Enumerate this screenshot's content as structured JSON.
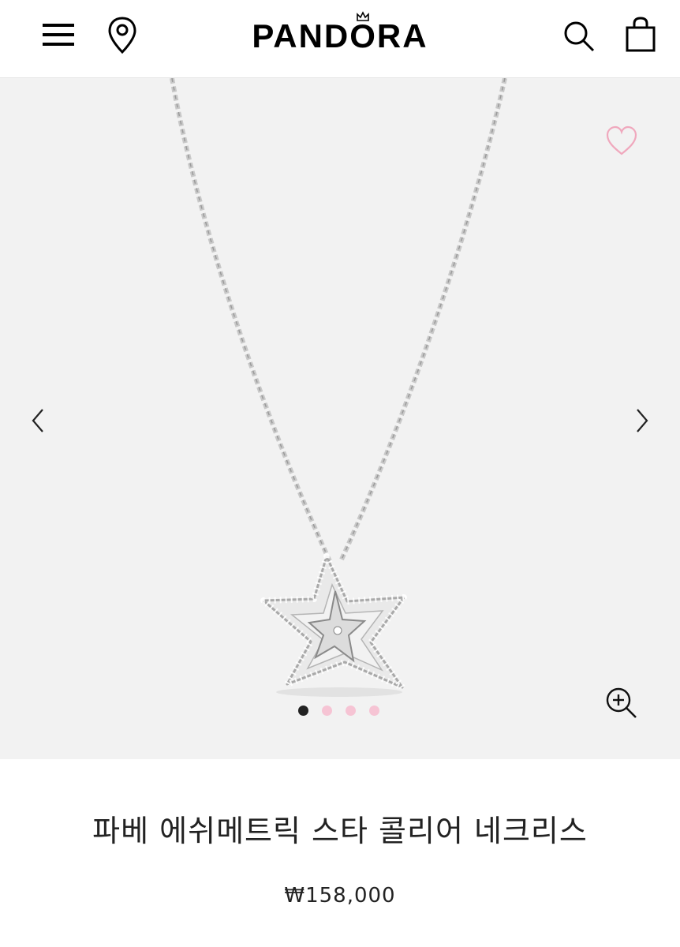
{
  "header": {
    "brand": "PANDORA",
    "icons": {
      "menu": "hamburger-menu-icon",
      "location": "map-pin-icon",
      "search": "search-icon",
      "bag": "shopping-bag-icon"
    }
  },
  "gallery": {
    "image": "star-pendant-necklace",
    "wishlist_icon": "heart-icon",
    "prev_icon": "chevron-left-icon",
    "next_icon": "chevron-right-icon",
    "zoom_icon": "zoom-in-icon",
    "slides_total": 4,
    "active_slide": 1
  },
  "product": {
    "title": "파베 에쉬메트릭 스타 콜리어 네크리스",
    "price": "₩158,000"
  },
  "colors": {
    "accent_pink": "#f6c4d4",
    "heart_pink": "#f0a8bd",
    "active_dot": "#222222",
    "gallery_bg": "#f2f2f2"
  }
}
